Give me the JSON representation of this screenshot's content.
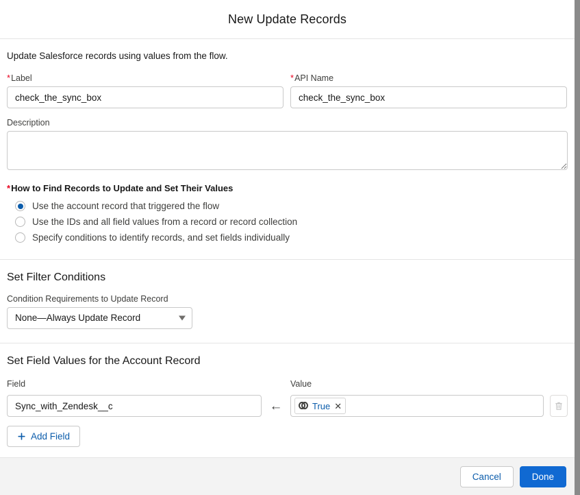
{
  "header": {
    "title": "New Update Records"
  },
  "intro": {
    "text": "Update Salesforce records using values from the flow."
  },
  "form": {
    "label_field": {
      "label": "Label",
      "required_marker": "*",
      "value": "check_the_sync_box",
      "placeholder": ""
    },
    "api_name_field": {
      "label": "API Name",
      "required_marker": "*",
      "value": "check_the_sync_box",
      "placeholder": ""
    },
    "description_field": {
      "label": "Description",
      "value": "",
      "placeholder": ""
    }
  },
  "how_to_find": {
    "required_marker": "*",
    "legend": "How to Find Records to Update and Set Their Values",
    "options": [
      {
        "label": "Use the account record that triggered the flow",
        "selected": true
      },
      {
        "label": "Use the IDs and all field values from a record or record collection",
        "selected": false
      },
      {
        "label": "Specify conditions to identify records, and set fields individually",
        "selected": false
      }
    ]
  },
  "filter_section": {
    "title": "Set Filter Conditions",
    "condition_label": "Condition Requirements to Update Record",
    "condition_value": "None—Always Update Record",
    "chevron_icon": "chevron-down-icon"
  },
  "field_values_section": {
    "title": "Set Field Values for the Account Record",
    "field_column_label": "Field",
    "value_column_label": "Value",
    "arrow_icon": "←",
    "rows": [
      {
        "field_value": "Sync_with_Zendesk__c",
        "field_placeholder": "",
        "value_pill": {
          "glyph_icon": "boolean-icon",
          "text": "True",
          "remove_icon": "✕"
        },
        "delete_icon": "trash-icon"
      }
    ],
    "add_field_label": "Add Field",
    "add_field_icon": "plus-icon"
  },
  "footer": {
    "cancel_label": "Cancel",
    "done_label": "Done"
  },
  "colors": {
    "brand_blue": "#1069d2",
    "link_blue": "#0b5cab",
    "required_red": "#ea001e",
    "border_gray": "#c9c9c9",
    "footer_bg": "#f3f3f3"
  }
}
